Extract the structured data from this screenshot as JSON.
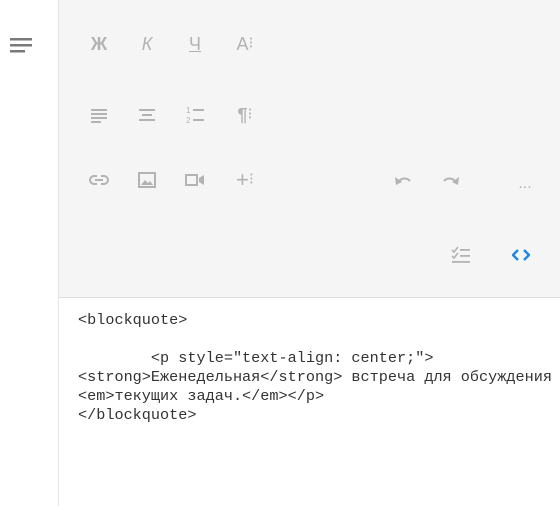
{
  "sidebar": {
    "menu_icon": "hamburger-menu-icon"
  },
  "toolbar": {
    "row1": {
      "bold_label": "Ж",
      "italic_label": "К",
      "underline_label": "Ч",
      "font_label": "A",
      "font_more": "⁝"
    },
    "row2": {
      "align_left_icon": "align-left-icon",
      "align_center_icon": "align-center-icon",
      "ordered_list_icon": "ordered-list-icon",
      "paragraph_label": "¶",
      "paragraph_more": "⁝"
    },
    "row3": {
      "link_icon": "link-icon",
      "image_icon": "image-icon",
      "video_icon": "video-icon",
      "insert_label": "+",
      "insert_more": "⁝",
      "undo_icon": "undo-icon",
      "redo_icon": "redo-icon",
      "more_label": "..."
    },
    "row4": {
      "spellcheck_icon": "spellcheck-icon",
      "code_view_icon": "code-view-icon"
    }
  },
  "colors": {
    "toolbar_bg": "#f5f5f5",
    "icon_inactive": "#b3b3b3",
    "accent": "#1e88e5"
  },
  "editor": {
    "code": "<blockquote>\n\n        <p style=\"text-align: center;\"><strong>Еженедельная</strong> встреча для обсуждения <em>текущих задач.</em></p>\n</blockquote>"
  }
}
